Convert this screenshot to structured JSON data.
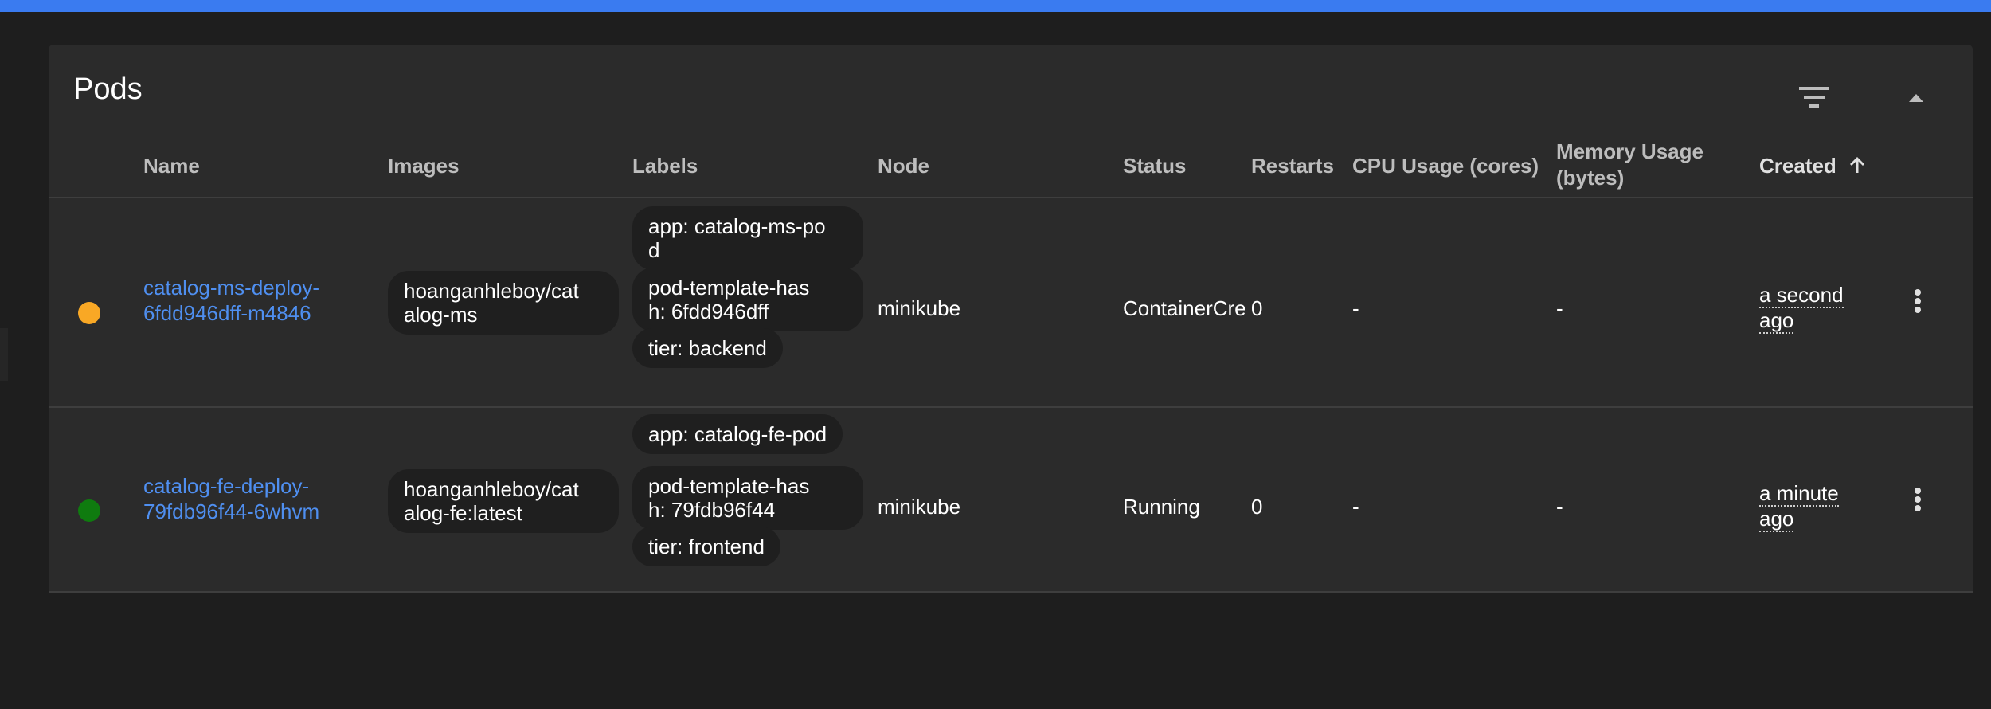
{
  "card": {
    "title": "Pods"
  },
  "table": {
    "headers": {
      "name": "Name",
      "images": "Images",
      "labels": "Labels",
      "node": "Node",
      "status": "Status",
      "restarts": "Restarts",
      "cpu": "CPU Usage (cores)",
      "memory_line1": "Memory Usage",
      "memory_line2": "(bytes)",
      "created": "Created"
    },
    "rows": [
      {
        "status_color": "#f9a825",
        "name_line1": "catalog-ms-deploy-",
        "name_line2": "6fdd946dff-m4846",
        "image_line1": "hoanganhleboy/cat",
        "image_line2": "alog-ms",
        "label1_line1": "app: catalog-ms-po",
        "label1_line2": "d",
        "label2_line1": "pod-template-has",
        "label2_line2": "h: 6fdd946dff",
        "label3": "tier: backend",
        "node": "minikube",
        "status": "ContainerCreating",
        "restarts": "0",
        "cpu": "-",
        "memory": "-",
        "created_line1": "a second",
        "created_line2": "ago"
      },
      {
        "status_color": "#0f7b0f",
        "name_line1": "catalog-fe-deploy-",
        "name_line2": "79fdb96f44-6whvm",
        "image_line1": "hoanganhleboy/cat",
        "image_line2": "alog-fe:latest",
        "label1": "app: catalog-fe-pod",
        "label2_line1": "pod-template-has",
        "label2_line2": "h: 79fdb96f44",
        "label3": "tier: frontend",
        "node": "minikube",
        "status": "Running",
        "restarts": "0",
        "cpu": "-",
        "memory": "-",
        "created_line1": "a minute",
        "created_line2": "ago"
      }
    ]
  },
  "icons": {
    "filter": "filter-icon",
    "collapse": "chevron-up-icon",
    "sort": "arrow-up-icon",
    "more": "more-vert-icon"
  }
}
